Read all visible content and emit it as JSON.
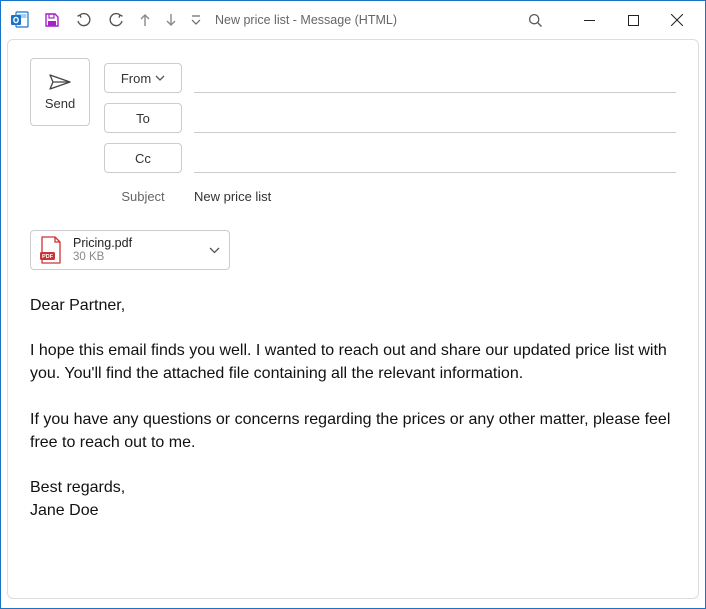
{
  "window": {
    "title": "New price list  -  Message (HTML)"
  },
  "toolbar": {
    "send_label": "Send"
  },
  "fields": {
    "from_label": "From",
    "to_label": "To",
    "cc_label": "Cc",
    "subject_label": "Subject",
    "subject_value": "New price list"
  },
  "attachment": {
    "name": "Pricing.pdf",
    "size": "30 KB"
  },
  "body": {
    "p1": "Dear Partner,",
    "p2": "I hope this email finds you well. I wanted to reach out and share our updated price list with you. You'll find the attached file containing all the relevant information.",
    "p3": "If you have any questions or concerns regarding the prices or any other matter, please feel free to reach out to me.",
    "p4": "Best regards,",
    "p5": "Jane Doe"
  }
}
